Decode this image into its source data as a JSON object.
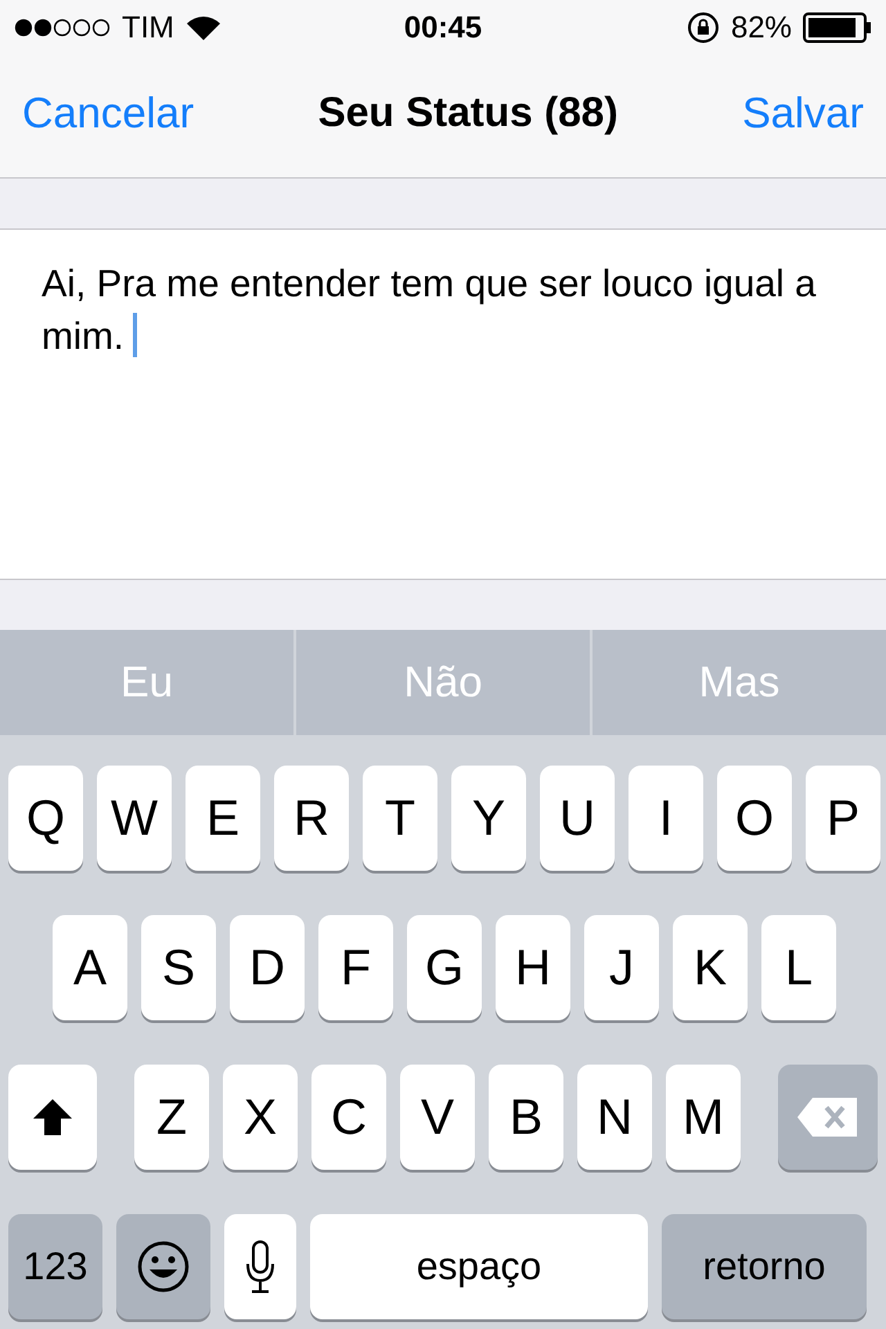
{
  "status_bar": {
    "carrier": "TIM",
    "time": "00:45",
    "battery": "82%"
  },
  "nav": {
    "cancel": "Cancelar",
    "title": "Seu Status (88)",
    "save": "Salvar"
  },
  "status_text": {
    "value": "Ai, Pra me entender tem que ser louco igual a mim."
  },
  "suggestions": [
    "Eu",
    "Não",
    "Mas"
  ],
  "keyboard": {
    "letter_rows": [
      {
        "keys": [
          {
            "kind": "letter",
            "label": "Q"
          },
          {
            "kind": "letter",
            "label": "W"
          },
          {
            "kind": "letter",
            "label": "E"
          },
          {
            "kind": "letter",
            "label": "R"
          },
          {
            "kind": "letter",
            "label": "T"
          },
          {
            "kind": "letter",
            "label": "Y"
          },
          {
            "kind": "letter",
            "label": "U"
          },
          {
            "kind": "letter",
            "label": "I"
          },
          {
            "kind": "letter",
            "label": "O"
          },
          {
            "kind": "letter",
            "label": "P"
          }
        ]
      },
      {
        "keys": [
          {
            "kind": "letter",
            "label": "A"
          },
          {
            "kind": "letter",
            "label": "S"
          },
          {
            "kind": "letter",
            "label": "D"
          },
          {
            "kind": "letter",
            "label": "F"
          },
          {
            "kind": "letter",
            "label": "G"
          },
          {
            "kind": "letter",
            "label": "H"
          },
          {
            "kind": "letter",
            "label": "J"
          },
          {
            "kind": "letter",
            "label": "K"
          },
          {
            "kind": "letter",
            "label": "L"
          }
        ]
      },
      {
        "keys": [
          {
            "kind": "shift",
            "on": true
          },
          {
            "kind": "letter",
            "label": "Z"
          },
          {
            "kind": "letter",
            "label": "X"
          },
          {
            "kind": "letter",
            "label": "C"
          },
          {
            "kind": "letter",
            "label": "V"
          },
          {
            "kind": "letter",
            "label": "B"
          },
          {
            "kind": "letter",
            "label": "N"
          },
          {
            "kind": "letter",
            "label": "M"
          },
          {
            "kind": "backspace"
          }
        ]
      }
    ],
    "bottom_row": [
      {
        "kind": "mode",
        "label": "123"
      },
      {
        "kind": "emoji"
      },
      {
        "kind": "mic"
      },
      {
        "kind": "space",
        "label": "espaço"
      },
      {
        "kind": "return",
        "label": "retorno"
      }
    ]
  }
}
